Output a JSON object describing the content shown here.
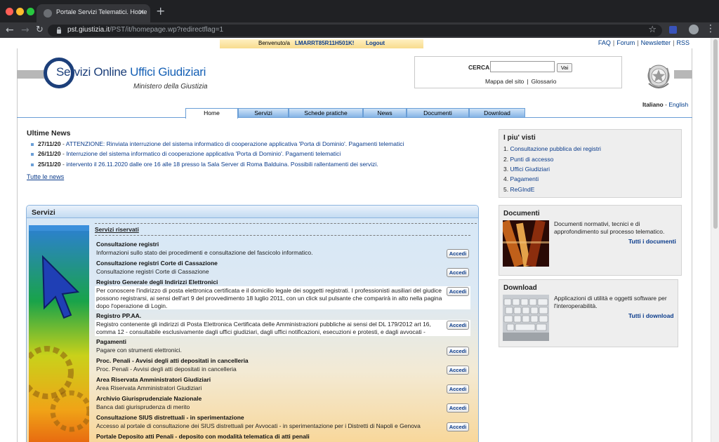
{
  "browser": {
    "tab_title": "Portale Servizi Telematici. Home",
    "tab_close": "✕",
    "new_tab": "+",
    "url_host": "pst.giustizia.it",
    "url_rest": "/PST/it/homepage.wp?redirectflag=1",
    "traffic_colors": [
      "#ff5f57",
      "#febc2e",
      "#28c840"
    ]
  },
  "top": {
    "welcome_prefix": "Benvenuto/a",
    "username": "LMARRT85R11H501K!",
    "logout": "Logout",
    "links": [
      "FAQ",
      "Forum",
      "Newsletter",
      "RSS"
    ]
  },
  "header": {
    "logo_s": "S",
    "logo_main": "ervizi Online",
    "logo_accent": "Uffici Giudiziari",
    "subtitle": "Ministero della Giustizia",
    "search_label": "CERCA",
    "search_value": "",
    "search_button": "Vai",
    "search_links": [
      "Mappa del sito",
      "Glossario"
    ],
    "lang_current": "Italiano",
    "lang_other": "English"
  },
  "nav": {
    "tabs": [
      "Home",
      "Servizi",
      "Schede pratiche",
      "News",
      "Documenti",
      "Download"
    ],
    "active": "Home"
  },
  "news": {
    "title": "Ultime News",
    "items": [
      {
        "date": "27/11/20",
        "text": "ATTENZIONE: Rinviata interruzione del sistema informatico di cooperazione applicativa 'Porta di Dominio'. Pagamenti telematici"
      },
      {
        "date": "26/11/20",
        "text": "Interruzione del sistema informatico di cooperazione applicativa 'Porta di Dominio'. Pagamenti telematici"
      },
      {
        "date": "25/11/20",
        "text": "intervento il 26.11.2020 dalle ore 16 alle 18 presso la Sala Server di Roma Balduina. Possibili rallentamenti dei servizi."
      }
    ],
    "all_link": "Tutte le news"
  },
  "servizi": {
    "title": "Servizi",
    "section": "Servizi riservati",
    "button_label": "Accedi",
    "items": [
      {
        "title": "Consultazione registri",
        "desc": "Informazioni sullo stato dei procedimenti e consultazione del fascicolo informatico."
      },
      {
        "title": "Consultazione registri Corte di Cassazione",
        "desc": "Consultazione registri Corte di Cassazione"
      },
      {
        "title": "Registro Generale degli Indirizzi Elettronici",
        "desc": "Per conoscere l'indirizzo di posta elettronica certificata e il domicilio legale dei soggetti registrati. I professionisti ausiliari del giudice possono registrarsi, ai sensi dell'art 9 del provvedimento 18 luglio 2011, con un click sul pulsante che comparirà in alto nella pagina dopo l'operazione di Login."
      },
      {
        "title": "Registro PP.AA.",
        "desc": "Registro contenente gli indirizzi di Posta Elettronica Certificata delle Amministrazioni pubbliche ai sensi del DL 179/2012 art 16, comma 12 - consultabile esclusivamente dagli uffici giudiziari, dagli uffici notificazioni, esecuzioni e protesti, e dagli avvocati -"
      },
      {
        "title": "Pagamenti",
        "desc": "Pagare con strumenti elettronici."
      },
      {
        "title": "Proc. Penali - Avvisi degli atti depositati in cancelleria",
        "desc": "Proc. Penali - Avvisi degli atti depositati in cancelleria"
      },
      {
        "title": "Area Riservata Amministratori Giudiziari",
        "desc": "Area Riservata Amministratori Giudiziari"
      },
      {
        "title": "Archivio Giurisprudenziale Nazionale",
        "desc": "Banca dati giurisprudenza di merito"
      },
      {
        "title": "Consultazione SIUS distrettuali - in sperimentazione",
        "desc": "Accesso al portale di consultazione dei SIUS distrettuali per Avvocati - in sperimentazione per i Distretti di Napoli e Genova"
      },
      {
        "title": "Portale Deposito atti Penali - deposito con modalità telematica di atti penali",
        "desc": ""
      }
    ]
  },
  "sidebar": {
    "piu_visti_title": "I piu' visti",
    "piu_visti": [
      {
        "num": "1.",
        "label": "Consultazione pubblica dei registri"
      },
      {
        "num": "2.",
        "label": "Punti di accesso"
      },
      {
        "num": "3.",
        "label": "Uffici Giudiziari"
      },
      {
        "num": "4.",
        "label": "Pagamenti"
      },
      {
        "num": "5.",
        "label": "ReGIndE"
      }
    ],
    "documenti_title": "Documenti",
    "documenti_desc": "Documenti normativi, tecnici e di approfondimento sul processo telematico.",
    "documenti_link": "Tutti i documenti",
    "download_title": "Download",
    "download_desc": "Applicazioni di utilità e oggetti software per l'interoperabilità.",
    "download_link": "Tutti i download"
  }
}
